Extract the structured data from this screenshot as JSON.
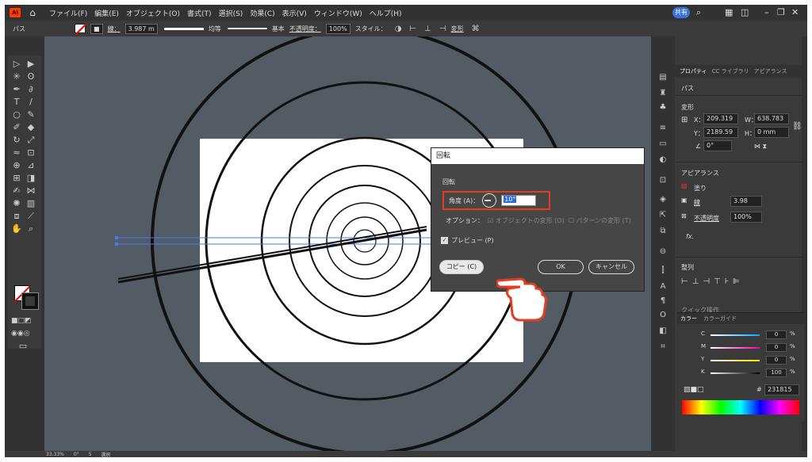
{
  "menubar": {
    "logo": "Ai",
    "menus": [
      "ファイル(F)",
      "編集(E)",
      "オブジェクト(O)",
      "書式(T)",
      "選択(S)",
      "効果(C)",
      "表示(V)",
      "ウィンドウ(W)",
      "ヘルプ(H)"
    ],
    "share": "共有"
  },
  "controlbar": {
    "object_type": "パス",
    "stroke_label": "線：",
    "stroke_value": "3.987 m",
    "stroke_profile": "均等",
    "brush": "基本",
    "opacity_label": "不透明度：",
    "opacity_value": "100%",
    "style_label": "スタイル：",
    "transform_label": "変形"
  },
  "dialog": {
    "title": "回転",
    "section": "回転",
    "angle_label": "角度 (A)：",
    "angle_value": "10°",
    "options_label": "オプション：",
    "opt_objects": "オブジェクトの変形 (O)",
    "opt_patterns": "パターンの変形 (T)",
    "preview_label": "プレビュー (P)",
    "copy_button": "コピー (C)",
    "ok_button": "OK",
    "cancel_button": "キャンセル"
  },
  "properties": {
    "tabs": [
      "プロパティ",
      "CC ライブラリ",
      "アピアランス"
    ],
    "object_type": "パス",
    "transform_heading": "変形",
    "x_label": "X：",
    "x_value": "209.319",
    "y_label": "Y：",
    "y_value": "2189.59",
    "w_label": "W：",
    "w_value": "638.783",
    "h_label": "H：",
    "h_value": "0 mm",
    "rotate_value": "0°",
    "appearance_heading": "アピアランス",
    "fill_label": "塗り",
    "stroke_label": "線",
    "stroke_value": "3.98",
    "opacity_label": "不透明度",
    "opacity_value": "100%",
    "fx_label": "fx.",
    "align_heading": "整列",
    "quick_actions": "クイック操作"
  },
  "color_panel": {
    "tabs": [
      "カラー",
      "カラーガイド"
    ],
    "c_label": "C",
    "c_value": "0",
    "m_label": "M",
    "m_value": "0",
    "y_label": "Y",
    "y_value": "0",
    "k_label": "K",
    "k_value": "100",
    "pct": "%",
    "hex": "231815"
  },
  "statusbar": {
    "zoom": "33.33%",
    "rotation": "0°",
    "page": "5",
    "tool": "選択"
  },
  "colors": {
    "accent_red": "#e43c1e",
    "canvas": "#535c64",
    "selection_blue": "#2b6cd8"
  }
}
